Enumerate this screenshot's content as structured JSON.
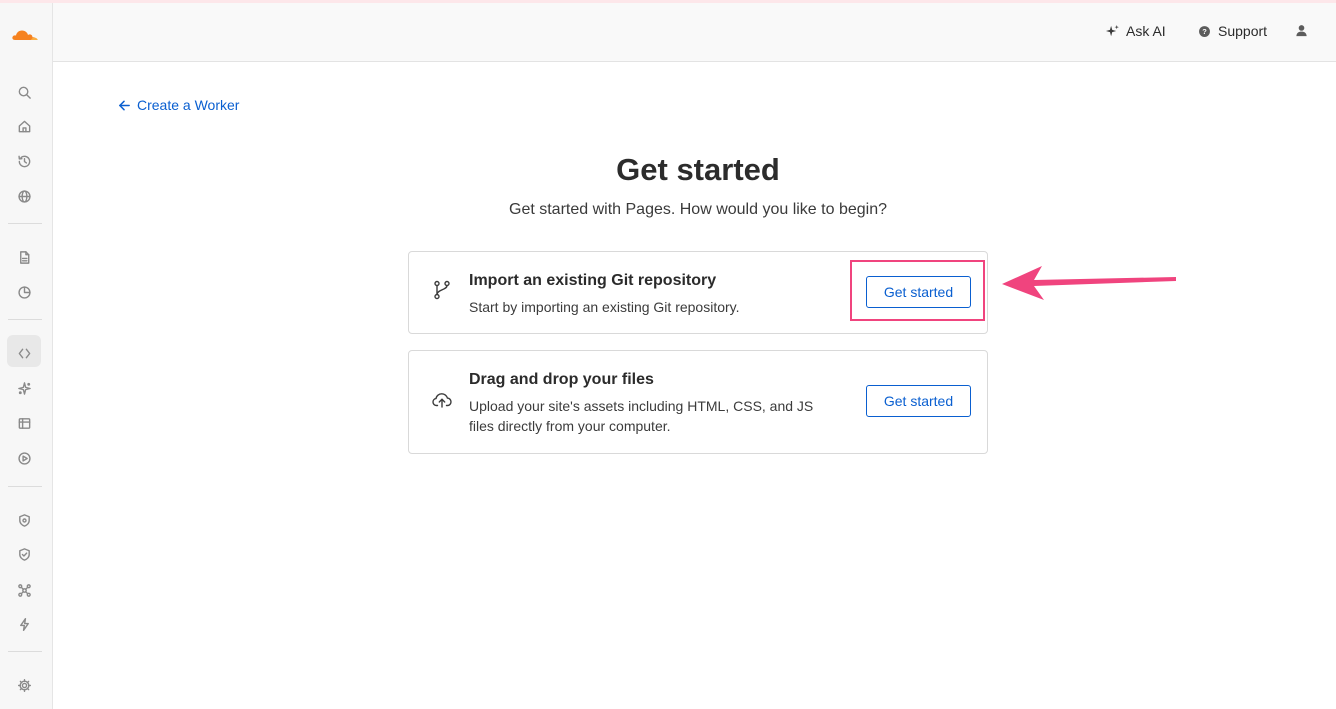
{
  "header": {
    "ask_ai_label": "Ask AI",
    "support_label": "Support",
    "icons": [
      "sparkle-icon",
      "help-icon",
      "user-icon"
    ]
  },
  "sidebar": {
    "icons": [
      "search-icon",
      "home-icon",
      "history-icon",
      "globe-icon",
      "document-icon",
      "chart-icon",
      "code-icon",
      "ai-icon",
      "storage-icon",
      "play-icon",
      "shield-icon",
      "shield-check-icon",
      "network-icon",
      "lightning-icon",
      "gear-icon"
    ],
    "active": "code-icon"
  },
  "main": {
    "back_link": "Create a Worker",
    "title": "Get started",
    "subtitle": "Get started with Pages. How would you like to begin?",
    "cards": [
      {
        "icon": "git-branch-icon",
        "title": "Import an existing Git repository",
        "description": "Start by importing an existing Git repository.",
        "button_label": "Get started"
      },
      {
        "icon": "cloud-upload-icon",
        "title": "Drag and drop your files",
        "description_line1": "Upload your site's assets including HTML, CSS, and JS",
        "description_line2": "files directly from your computer.",
        "button_label": "Get started"
      }
    ]
  },
  "annotation": {
    "color": "#f0447e"
  },
  "colors": {
    "link": "#0a5fd0",
    "brand": "#f6821f"
  }
}
